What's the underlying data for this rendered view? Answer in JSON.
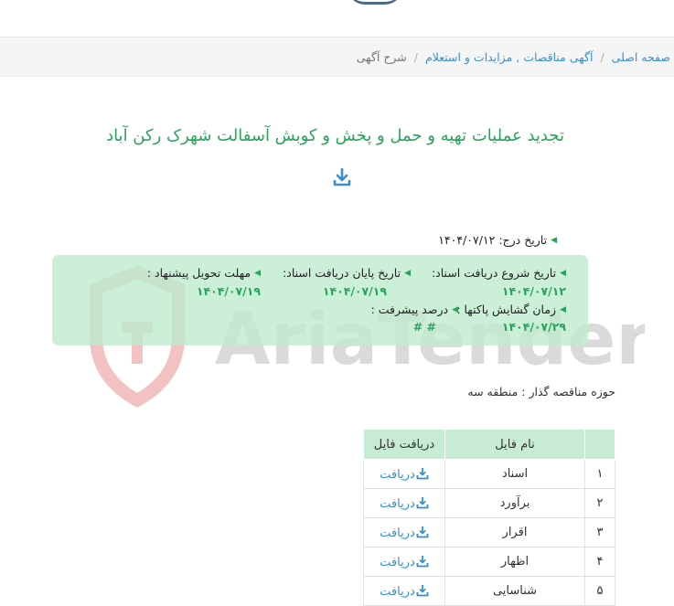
{
  "breadcrumb": {
    "items": [
      {
        "label": "صفحه اصلی"
      },
      {
        "label": "آگهی مناقصات , مزایدات و استعلام"
      },
      {
        "label": "شرح آگهی"
      }
    ]
  },
  "watermark": {
    "text": "AriaTender.neT"
  },
  "notice": {
    "title": "تجدید عملیات تهیه و حمل و پخش و کوبش آسفالت شهرک رکن آباد",
    "insert_date_label": "تاریخ درج:",
    "insert_date": "۱۴۰۴/۰۷/۱۲"
  },
  "info": {
    "doc_start_label": "تاریخ شروع دریافت اسناد:",
    "doc_start": "۱۴۰۴/۰۷/۱۲",
    "doc_end_label": "تاریخ پایان دریافت اسناد:",
    "doc_end": "۱۴۰۴/۰۷/۱۹",
    "deadline_label": "مهلت تحویل پیشنهاد :",
    "deadline": "۱۴۰۴/۰۷/۱۹",
    "opening_label": "زمان گشایش پاکتها :",
    "opening": "۱۴۰۴/۰۷/۲۹",
    "progress_label": "درصد پیشرفت :",
    "progress": "# #"
  },
  "organizer": {
    "text": "حوزه مناقصه گذار : منطقه سه"
  },
  "files_table": {
    "headers": {
      "num": "",
      "name": "نام فایل",
      "download": "دریافت فایل"
    },
    "rows": [
      {
        "num": "۱",
        "name": "اسناد",
        "download": "دریافت"
      },
      {
        "num": "۲",
        "name": "برآورد",
        "download": "دریافت"
      },
      {
        "num": "۳",
        "name": "اقرار",
        "download": "دریافت"
      },
      {
        "num": "۴",
        "name": "اظهار",
        "download": "دریافت"
      },
      {
        "num": "۵",
        "name": "شناسایی",
        "download": "دریافت"
      }
    ]
  },
  "colors": {
    "accent_green": "#2aa45a",
    "link_blue": "#3a8fcf",
    "box_bg": "#c7ecd3"
  }
}
